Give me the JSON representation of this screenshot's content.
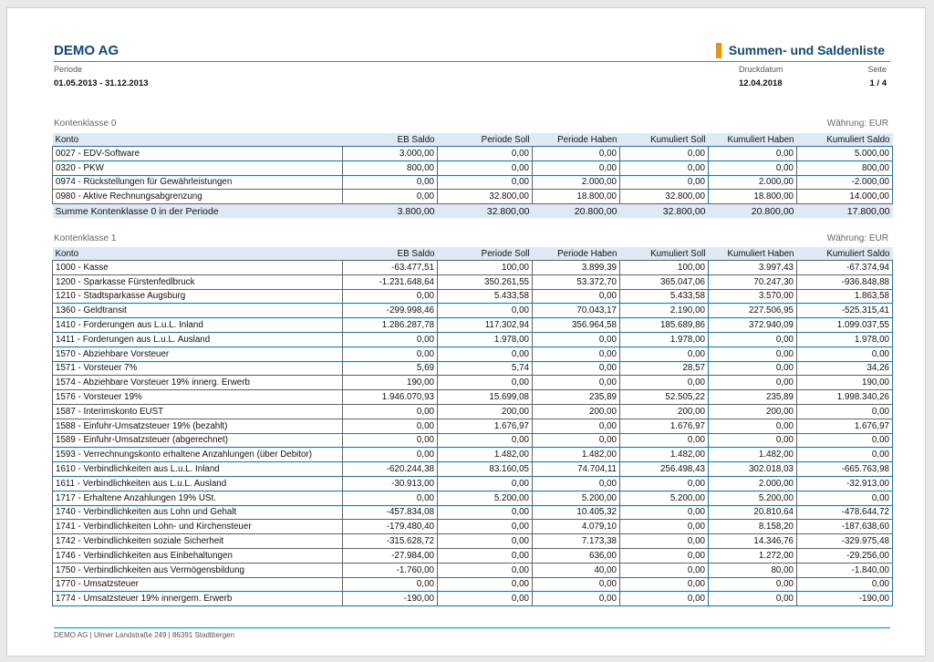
{
  "header": {
    "company": "DEMO AG",
    "title": "Summen- und Saldenliste",
    "period_label": "Periode",
    "period_value": "01.05.2013 - 31.12.2013",
    "print_date_label": "Druckdatum",
    "print_date_value": "12.04.2018",
    "page_label": "Seite",
    "page_value": "1 / 4"
  },
  "columns": [
    "Konto",
    "EB Saldo",
    "Periode Soll",
    "Periode Haben",
    "Kumuliert Soll",
    "Kumuliert Haben",
    "Kumuliert Saldo"
  ],
  "sections": [
    {
      "title": "Kontenklasse 0",
      "currency": "Währung: EUR",
      "rows": [
        [
          "0027 - EDV-Software",
          "3.000,00",
          "0,00",
          "0,00",
          "0,00",
          "0,00",
          "5.000,00"
        ],
        [
          "0320 - PKW",
          "800,00",
          "0,00",
          "0,00",
          "0,00",
          "0,00",
          "800,00"
        ],
        [
          "0974 - Rückstellungen für Gewährleistungen",
          "0,00",
          "0,00",
          "2.000,00",
          "0,00",
          "2.000,00",
          "-2.000,00"
        ],
        [
          "0980 - Aktive Rechnungsabgrenzung",
          "0,00",
          "32.800,00",
          "18.800,00",
          "32.800,00",
          "18.800,00",
          "14.000,00"
        ]
      ],
      "sum": [
        "Summe Kontenklasse 0 in der Periode",
        "3.800,00",
        "32.800,00",
        "20.800,00",
        "32.800,00",
        "20.800,00",
        "17.800,00"
      ]
    },
    {
      "title": "Kontenklasse 1",
      "currency": "Währung: EUR",
      "rows": [
        [
          "1000 - Kasse",
          "-63.477,51",
          "100,00",
          "3.899,39",
          "100,00",
          "3.997,43",
          "-67.374,94"
        ],
        [
          "1200 - Sparkasse Fürstenfedlbruck",
          "-1.231.648,64",
          "350.261,55",
          "53.372,70",
          "365.047,06",
          "70.247,30",
          "-936.848,88"
        ],
        [
          "1210 - Stadtsparkasse Augsburg",
          "0,00",
          "5.433,58",
          "0,00",
          "5.433,58",
          "3.570,00",
          "1.863,58"
        ],
        [
          "1360 - Geldtransit",
          "-299.998,46",
          "0,00",
          "70.043,17",
          "2.190,00",
          "227.506,95",
          "-525.315,41"
        ],
        [
          "1410 - Forderungen aus L.u.L. Inland",
          "1.286.287,78",
          "117.302,94",
          "356.964,58",
          "185.689,86",
          "372.940,09",
          "1.099.037,55"
        ],
        [
          "1411 - Forderungen aus L.u.L. Ausland",
          "0,00",
          "1.978,00",
          "0,00",
          "1.978,00",
          "0,00",
          "1.978,00"
        ],
        [
          "1570 - Abziehbare Vorsteuer",
          "0,00",
          "0,00",
          "0,00",
          "0,00",
          "0,00",
          "0,00"
        ],
        [
          "1571 - Vorsteuer 7%",
          "5,69",
          "5,74",
          "0,00",
          "28,57",
          "0,00",
          "34,26"
        ],
        [
          "1574 - Abziehbare Vorsteuer 19% innerg. Erwerb",
          "190,00",
          "0,00",
          "0,00",
          "0,00",
          "0,00",
          "190,00"
        ],
        [
          "1576 - Vorsteuer 19%",
          "1.946.070,93",
          "15.699,08",
          "235,89",
          "52.505,22",
          "235,89",
          "1.998.340,26"
        ],
        [
          "1587 - Interimskonto EUST",
          "0,00",
          "200,00",
          "200,00",
          "200,00",
          "200,00",
          "0,00"
        ],
        [
          "1588 - Einfuhr-Umsatzsteuer 19% (bezahlt)",
          "0,00",
          "1.676,97",
          "0,00",
          "1.676,97",
          "0,00",
          "1.676,97"
        ],
        [
          "1589 - Einfuhr-Umsatzsteuer (abgerechnet)",
          "0,00",
          "0,00",
          "0,00",
          "0,00",
          "0,00",
          "0,00"
        ],
        [
          "1593 - Verrechnungskonto erhaltene Anzahlungen (über Debitor)",
          "0,00",
          "1.482,00",
          "1.482,00",
          "1.482,00",
          "1.482,00",
          "0,00"
        ],
        [
          "1610 - Verbindlichkeiten aus L.u.L. Inland",
          "-620.244,38",
          "83.160,05",
          "74.704,11",
          "256.498,43",
          "302.018,03",
          "-665.763,98"
        ],
        [
          "1611 - Verbindlichkeiten aus L.u.L. Ausland",
          "-30.913,00",
          "0,00",
          "0,00",
          "0,00",
          "2.000,00",
          "-32.913,00"
        ],
        [
          "1717 - Erhaltene Anzahlungen 19% USt.",
          "0,00",
          "5.200,00",
          "5.200,00",
          "5.200,00",
          "5.200,00",
          "0,00"
        ],
        [
          "1740 - Verbindlichkeiten aus Lohn und Gehalt",
          "-457.834,08",
          "0,00",
          "10.405,32",
          "0,00",
          "20.810,64",
          "-478.644,72"
        ],
        [
          "1741 - Verbindlichkeiten Lohn- und Kirchensteuer",
          "-179.480,40",
          "0,00",
          "4.079,10",
          "0,00",
          "8.158,20",
          "-187.638,60"
        ],
        [
          "1742 - Verbindlichkeiten soziale Sicherheit",
          "-315.628,72",
          "0,00",
          "7.173,38",
          "0,00",
          "14.346,76",
          "-329.975,48"
        ],
        [
          "1746 - Verbindlichkeiten aus Einbehaltungen",
          "-27.984,00",
          "0,00",
          "636,00",
          "0,00",
          "1.272,00",
          "-29.256,00"
        ],
        [
          "1750 - Verbindlichkeiten aus Vermögensbildung",
          "-1.760,00",
          "0,00",
          "40,00",
          "0,00",
          "80,00",
          "-1.840,00"
        ],
        [
          "1770 - Umsatzsteuer",
          "0,00",
          "0,00",
          "0,00",
          "0,00",
          "0,00",
          "0,00"
        ],
        [
          "1774 - Umsatzsteuer 19% innergem. Erwerb",
          "-190,00",
          "0,00",
          "0,00",
          "0,00",
          "0,00",
          "-190,00"
        ]
      ]
    }
  ],
  "footer": "DEMO AG | Ulmer Landstraße 249 | 86391 Stadtbergen"
}
